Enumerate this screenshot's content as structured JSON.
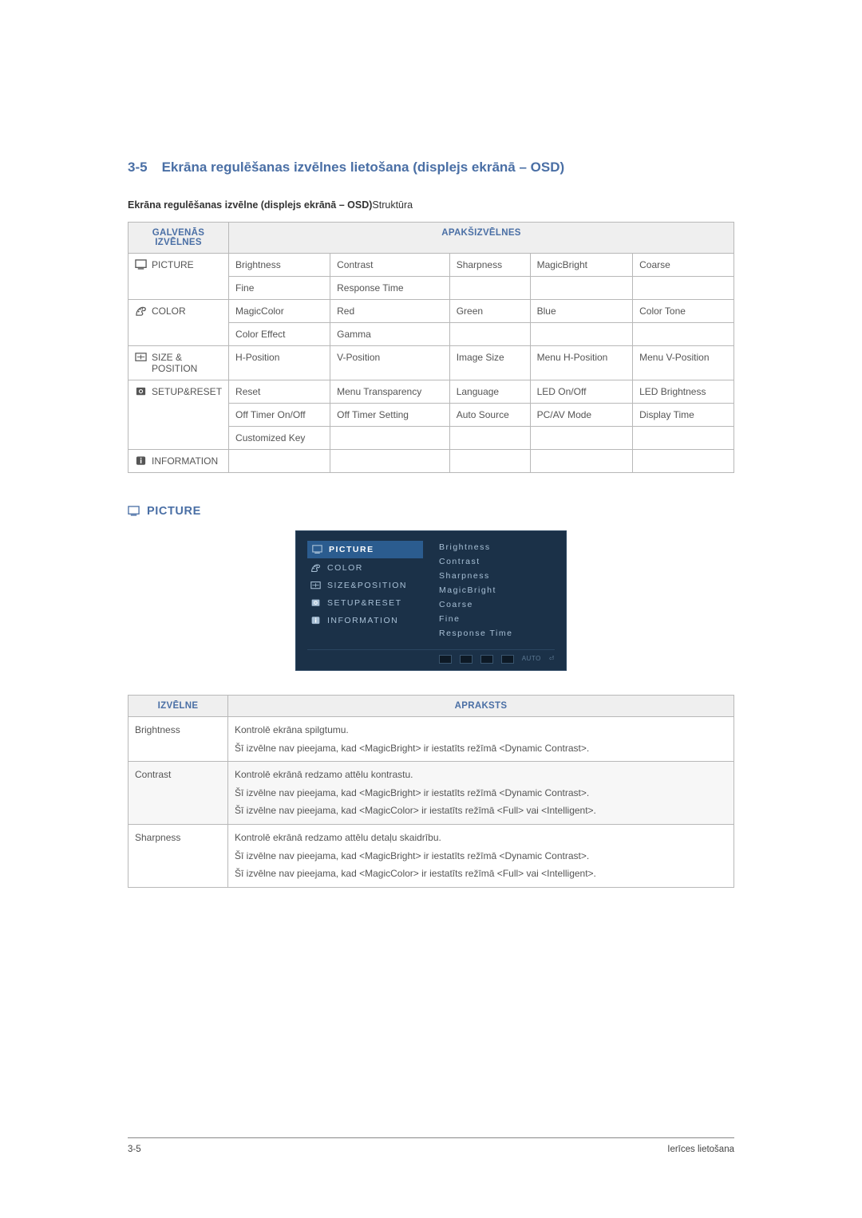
{
  "heading": {
    "number": "3-5",
    "title": "Ekrāna regulēšanas izvēlnes lietošana (displejs ekrānā – OSD)"
  },
  "structure_label": {
    "bold": "Ekrāna regulēšanas izvēlne (displejs ekrānā – OSD)",
    "rest": "Struktūra"
  },
  "menu_table": {
    "header_main": "GALVENĀS IZVĒLNES",
    "header_sub": "APAKŠIZVĒLNES",
    "rows": [
      {
        "category": "PICTURE",
        "icon": "picture-icon",
        "rowspan": 2,
        "cells": [
          [
            "Brightness",
            "Contrast",
            "Sharpness",
            "MagicBright",
            "Coarse"
          ],
          [
            "Fine",
            "Response Time",
            "",
            "",
            ""
          ]
        ]
      },
      {
        "category": "COLOR",
        "icon": "color-icon",
        "rowspan": 2,
        "cells": [
          [
            "MagicColor",
            "Red",
            "Green",
            "Blue",
            "Color Tone"
          ],
          [
            "Color Effect",
            "Gamma",
            "",
            "",
            ""
          ]
        ]
      },
      {
        "category": "SIZE & POSITION",
        "icon": "size-icon",
        "rowspan": 1,
        "cells": [
          [
            "H-Position",
            "V-Position",
            "Image Size",
            "Menu H-Position",
            "Menu V-Position"
          ]
        ]
      },
      {
        "category": "SETUP&RESET",
        "icon": "setup-icon",
        "rowspan": 3,
        "cells": [
          [
            "Reset",
            "Menu Transparency",
            "Language",
            "LED On/Off",
            "LED Brightness"
          ],
          [
            "Off Timer On/Off",
            "Off Timer Setting",
            "Auto Source",
            "PC/AV Mode",
            "Display Time"
          ],
          [
            "Customized Key",
            "",
            "",
            "",
            ""
          ]
        ]
      },
      {
        "category": "INFORMATION",
        "icon": "info-icon",
        "rowspan": 1,
        "cells": [
          [
            "",
            "",
            "",
            "",
            ""
          ]
        ]
      }
    ]
  },
  "picture_section_title": "PICTURE",
  "osd": {
    "left_items": [
      {
        "label": "PICTURE",
        "selected": true
      },
      {
        "label": "COLOR",
        "selected": false
      },
      {
        "label": "SIZE&POSITION",
        "selected": false
      },
      {
        "label": "SETUP&RESET",
        "selected": false
      },
      {
        "label": "INFORMATION",
        "selected": false
      }
    ],
    "right_items": [
      "Brightness",
      "Contrast",
      "Sharpness",
      "MagicBright",
      "Coarse",
      "Fine",
      "Response Time"
    ],
    "footer_labels": [
      "AUTO",
      "⏎"
    ]
  },
  "desc_table": {
    "header_menu": "IZVĒLNE",
    "header_desc": "APRAKSTS",
    "rows": [
      {
        "name": "Brightness",
        "lines": [
          "Kontrolē ekrāna spilgtumu.",
          "Šī izvēlne nav pieejama, kad <MagicBright> ir iestatīts režīmā <Dynamic Contrast>."
        ]
      },
      {
        "name": "Contrast",
        "lines": [
          "Kontrolē ekrānā redzamo attēlu kontrastu.",
          "Šī izvēlne nav pieejama, kad <MagicBright> ir iestatīts režīmā <Dynamic Contrast>.",
          "Šī izvēlne nav pieejama, kad <MagicColor> ir iestatīts režīmā <Full> vai <Intelligent>."
        ]
      },
      {
        "name": "Sharpness",
        "lines": [
          "Kontrolē ekrānā redzamo attēlu detaļu skaidrību.",
          "Šī izvēlne nav pieejama, kad <MagicBright> ir iestatīts režīmā <Dynamic Contrast>.",
          "Šī izvēlne nav pieejama, kad <MagicColor> ir iestatīts režīmā <Full> vai <Intelligent>."
        ]
      }
    ]
  },
  "footer": {
    "left": "3-5",
    "right": "Ierīces lietošana"
  }
}
